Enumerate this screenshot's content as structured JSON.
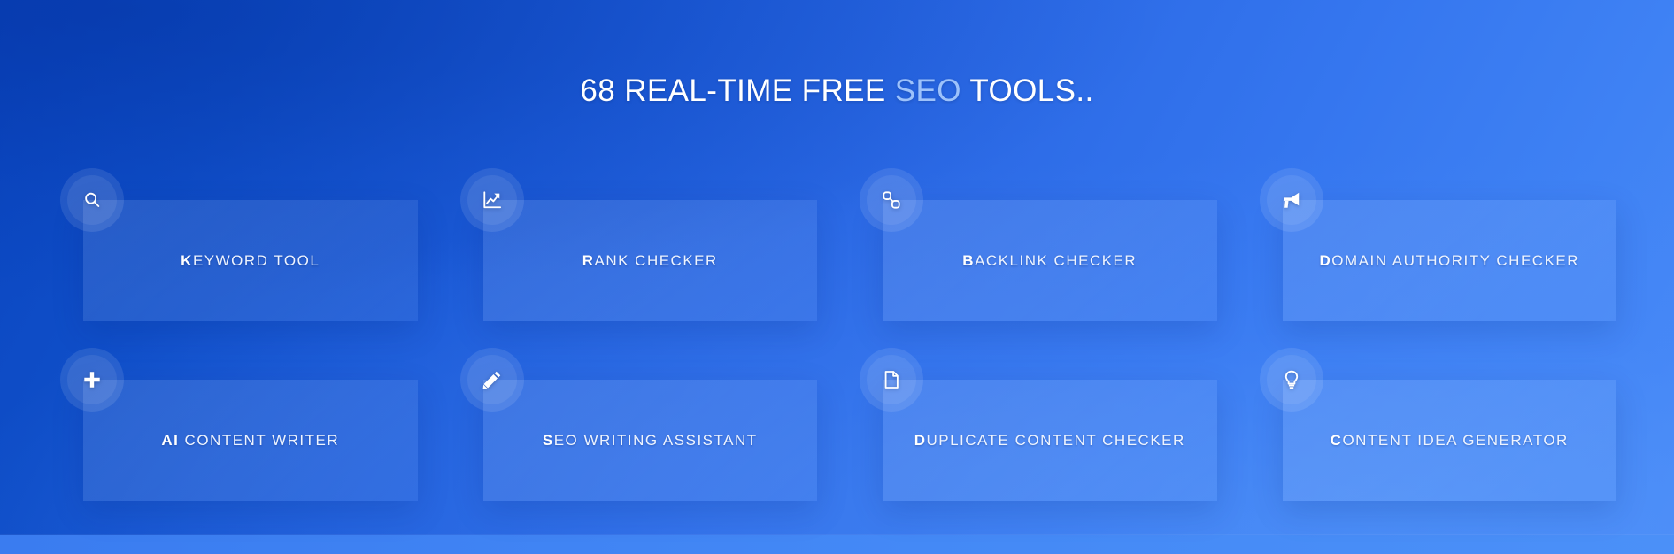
{
  "heading": {
    "before": "68 REAL-TIME FREE ",
    "accent": "SEO",
    "after": " TOOLS..",
    "accent_color": "#9dc2fb",
    "full_text": "68 REAL-TIME FREE SEO TOOLS..",
    "tool_count": 68
  },
  "theme": {
    "background_top_left": "#0a45bf",
    "background_bottom_right": "#4a8bf7",
    "card_fill": "rgba(255,255,255,0.10)",
    "text_color": "#eef4ff"
  },
  "tools": [
    {
      "label": "KEYWORD TOOL",
      "lead": "K",
      "rest": "EYWORD TOOL",
      "icon": "search-icon"
    },
    {
      "label": "RANK CHECKER",
      "lead": "R",
      "rest": "ANK CHECKER",
      "icon": "chart-line-up-icon"
    },
    {
      "label": "BACKLINK CHECKER",
      "lead": "B",
      "rest": "ACKLINK CHECKER",
      "icon": "link-chain-icon"
    },
    {
      "label": "DOMAIN AUTHORITY CHECKER",
      "lead": "D",
      "rest": "OMAIN AUTHORITY CHECKER",
      "icon": "megaphone-icon"
    },
    {
      "label": "AI CONTENT WRITER",
      "lead": "AI",
      "rest": " CONTENT WRITER",
      "icon": "plus-icon"
    },
    {
      "label": "SEO WRITING ASSISTANT",
      "lead": "S",
      "rest": "EO WRITING ASSISTANT",
      "icon": "pencil-icon"
    },
    {
      "label": "DUPLICATE CONTENT CHECKER",
      "lead": "D",
      "rest": "UPLICATE CONTENT CHECKER",
      "icon": "document-icon"
    },
    {
      "label": "CONTENT IDEA GENERATOR",
      "lead": "C",
      "rest": "ONTENT IDEA GENERATOR",
      "icon": "lightbulb-icon"
    }
  ]
}
